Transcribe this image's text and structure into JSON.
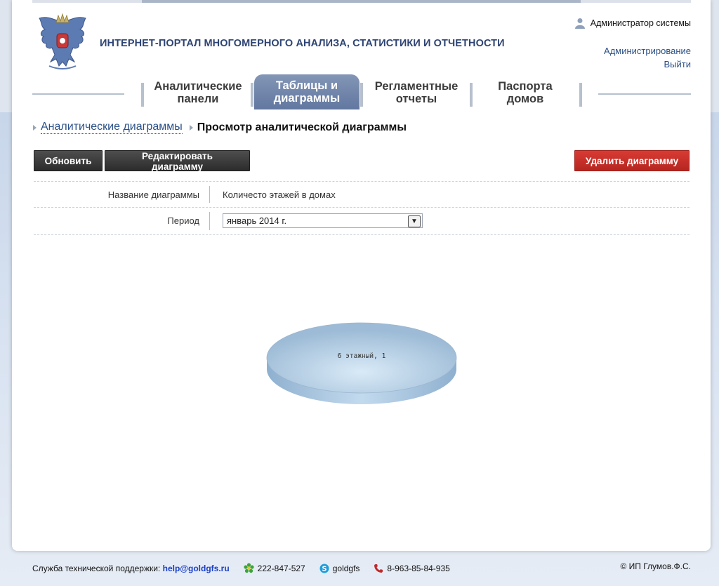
{
  "header": {
    "portal_title": "ИНТЕРНЕТ-ПОРТАЛ МНОГОМЕРНОГО АНАЛИЗА, СТАТИСТИКИ И ОТЧЕТНОСТИ",
    "user_name": "Администратор системы",
    "admin_link": "Администрирование",
    "logout_link": "Выйти"
  },
  "nav": {
    "tabs": [
      {
        "line1": "Аналитические",
        "line2": "панели",
        "active": false
      },
      {
        "line1": "Таблицы и",
        "line2": "диаграммы",
        "active": true
      },
      {
        "line1": "Регламентные",
        "line2": "отчеты",
        "active": false
      },
      {
        "line1": "Паспорта",
        "line2": "домов",
        "active": false
      }
    ]
  },
  "breadcrumb": {
    "parent": "Аналитические диаграммы",
    "current": "Просмотр аналитической диаграммы"
  },
  "toolbar": {
    "refresh_label": "Обновить",
    "edit_label": "Редактировать диаграмму",
    "delete_label": "Удалить диаграмму"
  },
  "form": {
    "name_label": "Название диаграммы",
    "name_value": "Количесто этажей в домах",
    "period_label": "Период",
    "period_value": "январь 2014 г."
  },
  "chart_data": {
    "type": "pie",
    "categories": [
      "6 этажный"
    ],
    "values": [
      1
    ],
    "slice_label": "6 этажный, 1",
    "color": "#a9c6e0"
  },
  "footer": {
    "support_text": "Служба технической поддержки:",
    "support_email": "help@goldgfs.ru",
    "icq": "222-847-527",
    "skype": "goldgfs",
    "phone": "8-963-85-84-935",
    "copyright": "© ИП Глумов.Ф.С."
  }
}
